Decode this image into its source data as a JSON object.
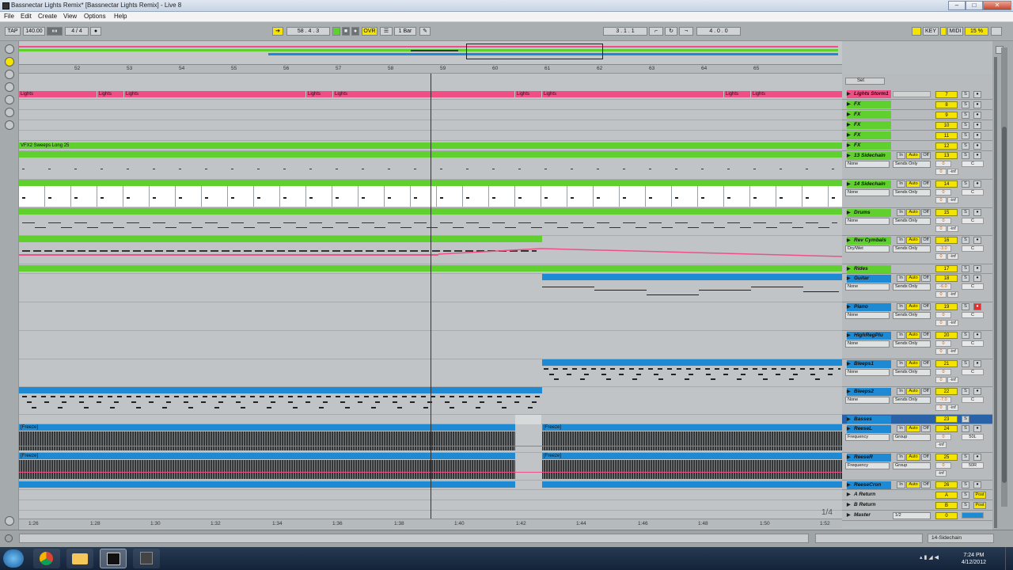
{
  "window": {
    "title": "Bassnectar Lights Remix*  [Bassnectar Lights Remix] - Live 8"
  },
  "menu": [
    "File",
    "Edit",
    "Create",
    "View",
    "Options",
    "Help"
  ],
  "control": {
    "tap": "TAP",
    "tempo": "140.00",
    "sig": "4 / 4",
    "position": "58 .  4 .  3",
    "ovr": "OVR",
    "quant": "1 Bar",
    "loop_start": "3 .  1 .  1",
    "loop_len": "4 .  0 .  0",
    "key": "KEY",
    "midi": "MIDI",
    "cpu": "15 %"
  },
  "ruler": [
    "52",
    "53",
    "54",
    "55",
    "56",
    "57",
    "58",
    "59",
    "60",
    "61",
    "62",
    "63",
    "64",
    "65"
  ],
  "time": [
    "1:26",
    "1:28",
    "1:30",
    "1:32",
    "1:34",
    "1:36",
    "1:38",
    "1:40",
    "1:42",
    "1:44",
    "1:46",
    "1:48",
    "1:50",
    "1:52"
  ],
  "page_indicator": "1/4",
  "clips": {
    "lights": "Lights",
    "sweep": "VFX2 Sweeps Long 25",
    "freeze": "[Freeze]"
  },
  "set_label": "Set",
  "tracks": [
    {
      "name": "Lights Storm1",
      "num": "7",
      "color": "#f04f86"
    },
    {
      "name": "FX",
      "num": "8",
      "color": "#5fd02d"
    },
    {
      "name": "FX",
      "num": "9",
      "color": "#5fd02d"
    },
    {
      "name": "FX",
      "num": "10",
      "color": "#5fd02d"
    },
    {
      "name": "FX",
      "num": "11",
      "color": "#5fd02d"
    },
    {
      "name": "FX",
      "num": "12",
      "color": "#5fd02d"
    },
    {
      "name": "13 Sidechain",
      "num": "13",
      "color": "#5fd02d",
      "in": "None",
      "out": "Sends Only",
      "vol": "0",
      "pan": "C"
    },
    {
      "name": "14 Sidechain",
      "num": "14",
      "color": "#5fd02d",
      "in": "None",
      "out": "Sends Only",
      "vol": "0",
      "pan": "C"
    },
    {
      "name": "Drums",
      "num": "15",
      "color": "#5fd02d",
      "in": "None",
      "out": "Sends Only",
      "vol": "0",
      "pan": "C"
    },
    {
      "name": "Rev Cymbals",
      "num": "16",
      "color": "#5fd02d",
      "in": "Dry/Wet",
      "out": "Sends Only",
      "vol": "-3.0",
      "pan": "C"
    },
    {
      "name": "Rides",
      "num": "17",
      "color": "#5fd02d"
    },
    {
      "name": "Guitar",
      "num": "18",
      "color": "#1e8ad4",
      "in": "None",
      "out": "Sends Only",
      "vol": "-6.0",
      "pan": "C"
    },
    {
      "name": "Piano",
      "num": "19",
      "color": "#1e8ad4",
      "in": "None",
      "out": "Sends Only",
      "vol": "0",
      "pan": "C"
    },
    {
      "name": "HighRegPlu",
      "num": "20",
      "color": "#1e8ad4",
      "in": "None",
      "out": "Sends Only",
      "vol": "0",
      "pan": "C"
    },
    {
      "name": "Bleeps1",
      "num": "21",
      "color": "#1e8ad4",
      "in": "None",
      "out": "Sends Only",
      "vol": "0",
      "pan": "C"
    },
    {
      "name": "Bleeps2",
      "num": "22",
      "color": "#1e8ad4",
      "in": "None",
      "out": "Sends Only",
      "vol": "-7.0",
      "pan": "C"
    },
    {
      "name": "Basses",
      "num": "23",
      "color": "#1e8ad4"
    },
    {
      "name": "ReeseL",
      "num": "24",
      "color": "#1e8ad4",
      "in": "Frequency",
      "out": "Group",
      "vol": "0",
      "pan": "50L"
    },
    {
      "name": "ReeseR",
      "num": "25",
      "color": "#1e8ad4",
      "in": "Frequency",
      "out": "Group",
      "vol": "0",
      "pan": "50R"
    },
    {
      "name": "ReeseCron",
      "num": "26",
      "color": "#1e8ad4"
    }
  ],
  "returns": [
    {
      "name": "A Return",
      "num": "A",
      "post": "Post"
    },
    {
      "name": "B Return",
      "num": "B",
      "post": "Post"
    },
    {
      "name": "Master",
      "num": "0",
      "out": "1/2"
    }
  ],
  "labels": {
    "in": "In",
    "auto": "Auto",
    "off": "Off",
    "s": "S",
    "inf": "-inf"
  },
  "status": {
    "sidechain": "14-Sidechain"
  },
  "clock": {
    "time": "7:24 PM",
    "date": "4/12/2012"
  }
}
